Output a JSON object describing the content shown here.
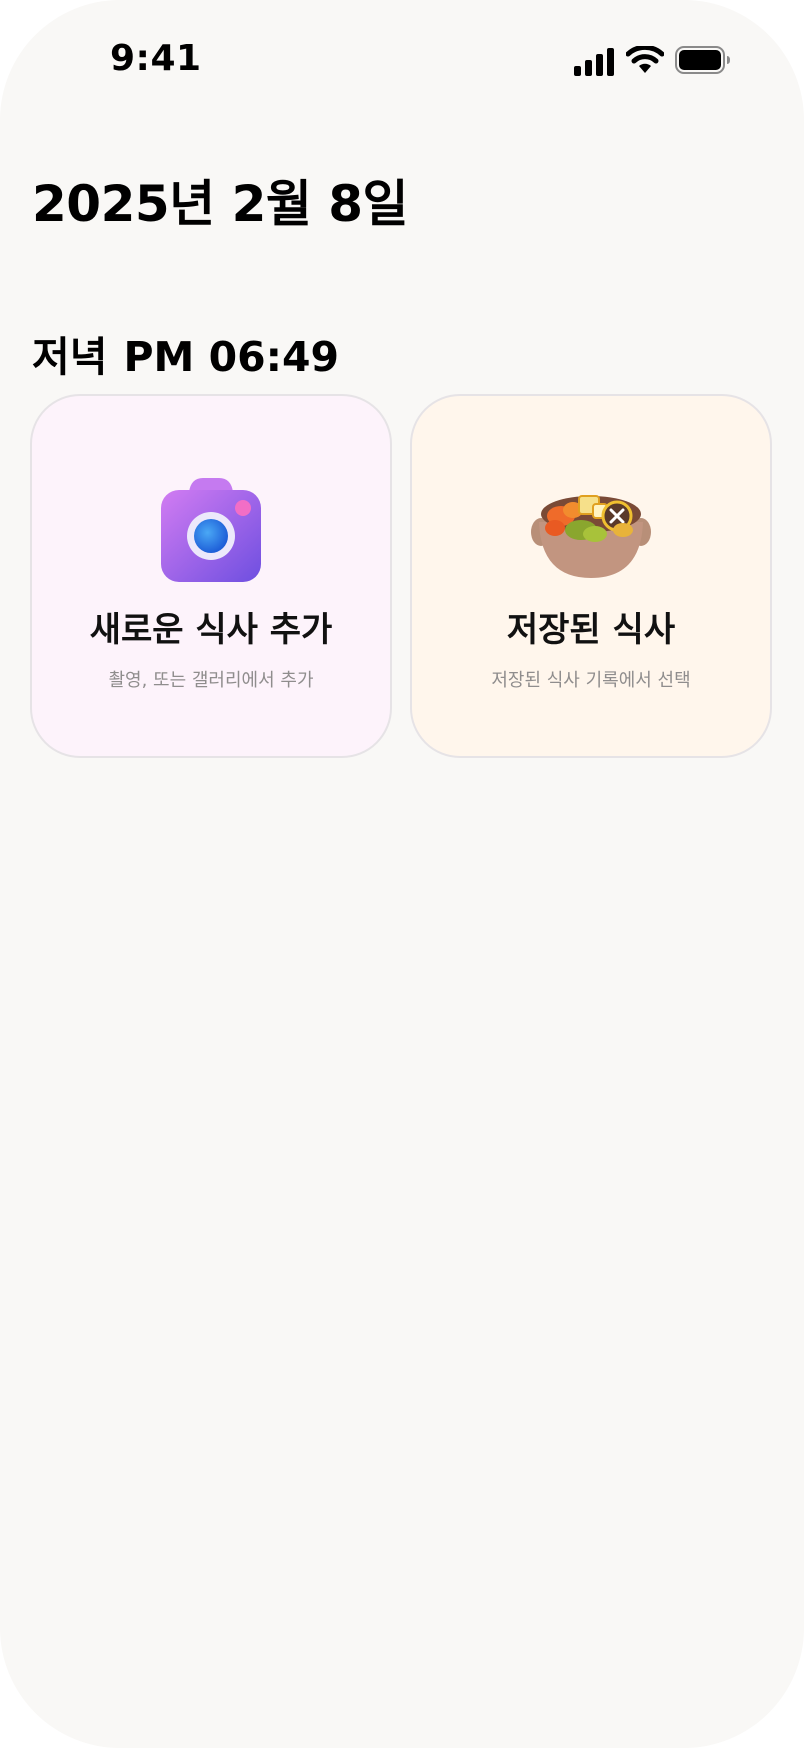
{
  "status_bar": {
    "time": "9:41"
  },
  "header": {
    "date": "2025년 2월 8일"
  },
  "meal": {
    "label": "저녁",
    "time": "PM 06:49"
  },
  "cards": [
    {
      "title": "새로운 식사 추가",
      "subtitle": "촬영, 또는 갤러리에서 추가",
      "icon": "camera-icon"
    },
    {
      "title": "저장된 식사",
      "subtitle": "저장된 식사 기록에서 선택",
      "icon": "hotpot-icon"
    }
  ],
  "colors": {
    "background": "#f9f8f6",
    "add_card_bg": "#fdf3fb",
    "saved_card_bg": "#fff6ec",
    "card_border": "#e6e3e6",
    "subtitle": "#8f8d8d"
  }
}
